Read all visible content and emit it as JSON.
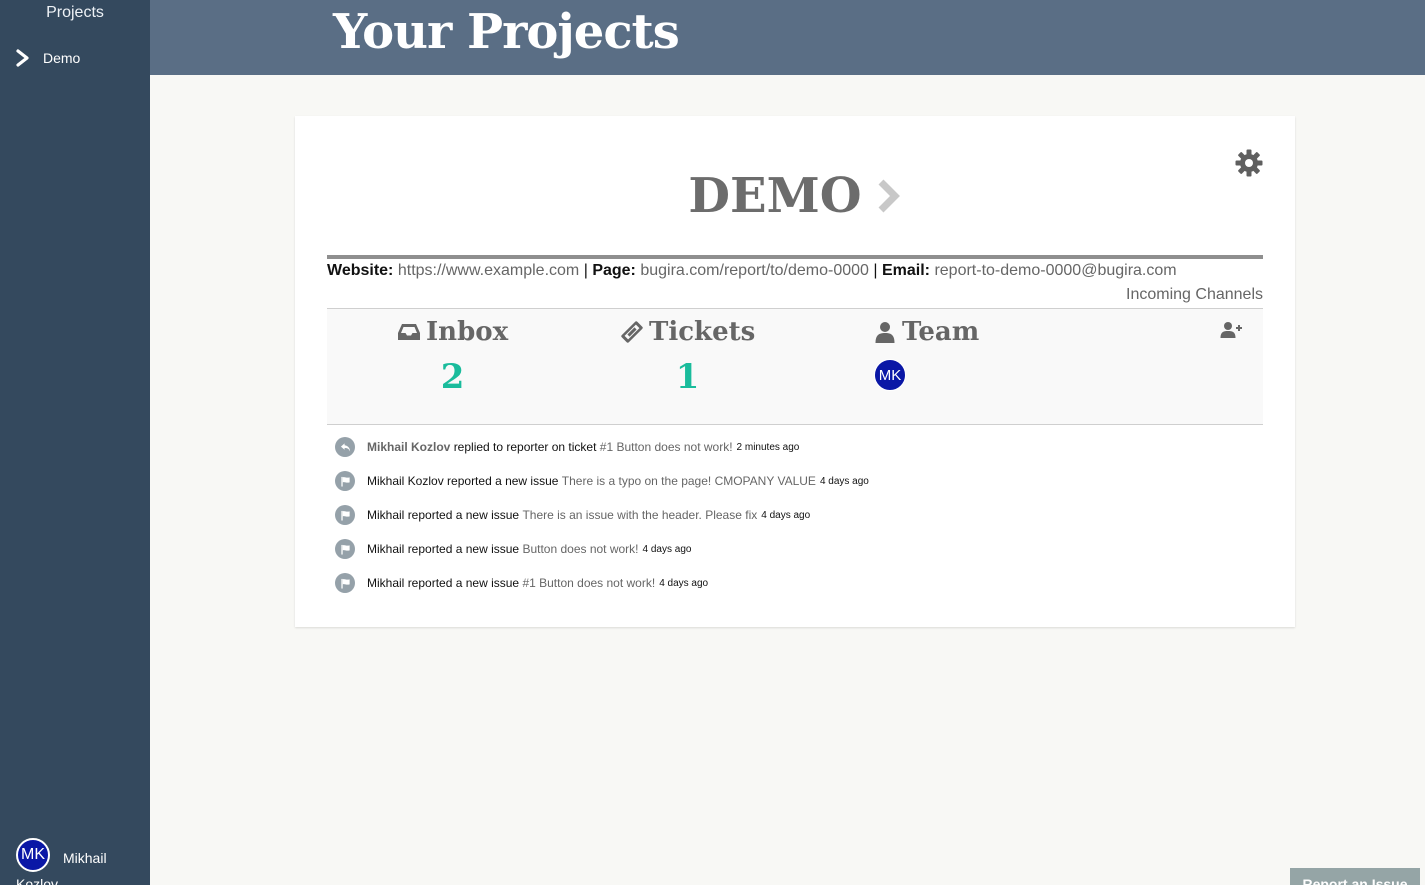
{
  "sidebar": {
    "heading": "Projects",
    "items": [
      {
        "label": "Demo"
      }
    ],
    "user": {
      "initials": "MK",
      "name": "Mikhail Kozlov"
    }
  },
  "header": {
    "title": "Your Projects"
  },
  "project": {
    "name": "DEMO",
    "info": {
      "website_label": "Website:",
      "website": "https://www.example.com",
      "page_label": "Page:",
      "page": "bugira.com/report/to/demo-0000",
      "email_label": "Email:",
      "email": "report-to-demo-0000@bugira.com",
      "separator": "|"
    },
    "channels_link": "Incoming Channels",
    "stats": {
      "inbox": {
        "label": "Inbox",
        "count": "2"
      },
      "tickets": {
        "label": "Tickets",
        "count": "1"
      },
      "team": {
        "label": "Team",
        "members": [
          {
            "initials": "MK"
          }
        ]
      }
    },
    "activity": [
      {
        "icon": "reply-icon",
        "actor": "Mikhail Kozlov",
        "action": "replied to reporter on ticket",
        "target": "#1 Button does not work!",
        "time": "2 minutes ago",
        "actor_bold": true
      },
      {
        "icon": "flag-icon",
        "actor": "Mikhail Kozlov",
        "action": "reported a new issue",
        "target": "There is a typo on the page! CMOPANY VALUE",
        "time": "4 days ago",
        "actor_bold": false
      },
      {
        "icon": "flag-icon",
        "actor": "Mikhail",
        "action": "reported a new issue",
        "target": "There is an issue with the header. Please fix",
        "time": "4 days ago",
        "actor_bold": false
      },
      {
        "icon": "flag-icon",
        "actor": "Mikhail",
        "action": "reported a new issue",
        "target": "Button does not work!",
        "time": "4 days ago",
        "actor_bold": false
      },
      {
        "icon": "flag-icon",
        "actor": "Mikhail",
        "action": "reported a new issue",
        "target": "#1 Button does not work!",
        "time": "4 days ago",
        "actor_bold": false
      }
    ]
  },
  "report_button": {
    "label": "Report an Issue"
  },
  "colors": {
    "sidebar": "#34495e",
    "header": "#5a6e85",
    "accent": "#1abc9c",
    "avatar": "#0a17a6"
  }
}
